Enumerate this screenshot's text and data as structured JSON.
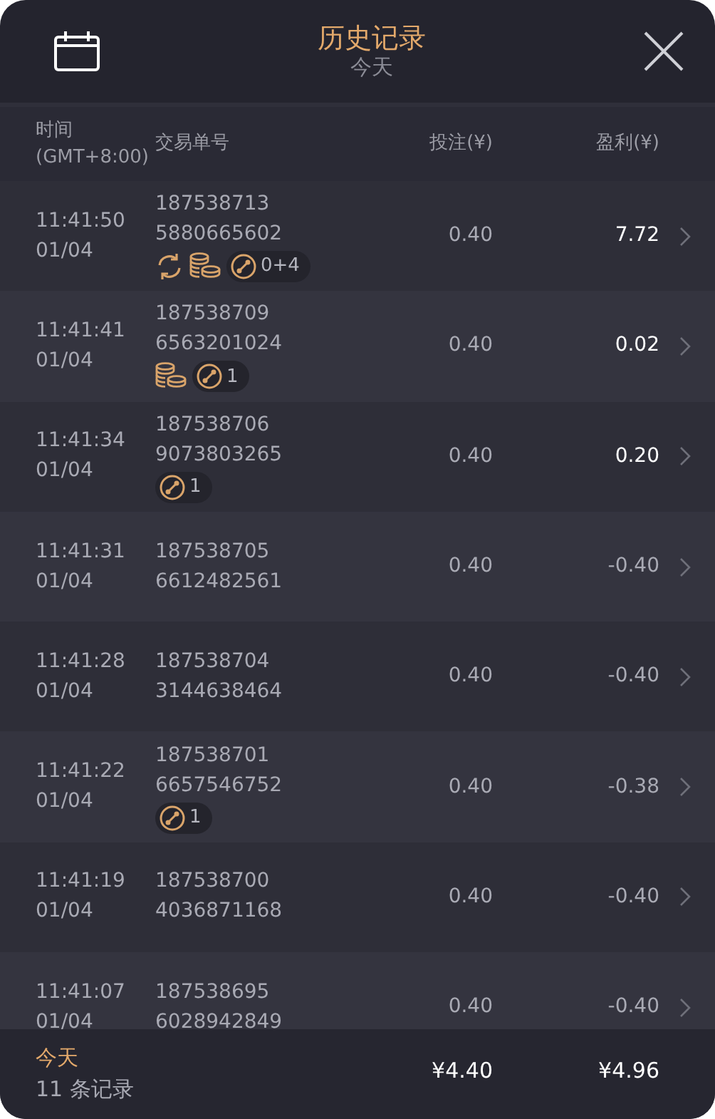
{
  "header": {
    "title": "历史记录",
    "subtitle": "今天"
  },
  "columns": {
    "time": "时间",
    "timezone": "(GMT+8:00)",
    "order": "交易单号",
    "bet": "投注(¥)",
    "profit": "盈利(¥)"
  },
  "rows": [
    {
      "time": "11:41:50",
      "date": "01/04",
      "order_a": "187538713",
      "order_b": "5880665602",
      "tags": [
        {
          "kind": "refresh"
        },
        {
          "kind": "coins"
        },
        {
          "kind": "parlay",
          "count": "0+4"
        }
      ],
      "bet": "0.40",
      "profit": "7.72",
      "win": true
    },
    {
      "time": "11:41:41",
      "date": "01/04",
      "order_a": "187538709",
      "order_b": "6563201024",
      "tags": [
        {
          "kind": "coins"
        },
        {
          "kind": "parlay",
          "count": "1"
        }
      ],
      "bet": "0.40",
      "profit": "0.02",
      "win": true
    },
    {
      "time": "11:41:34",
      "date": "01/04",
      "order_a": "187538706",
      "order_b": "9073803265",
      "tags": [
        {
          "kind": "parlay",
          "count": "1"
        }
      ],
      "bet": "0.40",
      "profit": "0.20",
      "win": true
    },
    {
      "time": "11:41:31",
      "date": "01/04",
      "order_a": "187538705",
      "order_b": "6612482561",
      "bet": "0.40",
      "profit": "-0.40",
      "win": false
    },
    {
      "time": "11:41:28",
      "date": "01/04",
      "order_a": "187538704",
      "order_b": "3144638464",
      "bet": "0.40",
      "profit": "-0.40",
      "win": false
    },
    {
      "time": "11:41:22",
      "date": "01/04",
      "order_a": "187538701",
      "order_b": "6657546752",
      "tags": [
        {
          "kind": "parlay",
          "count": "1"
        }
      ],
      "bet": "0.40",
      "profit": "-0.38",
      "win": false
    },
    {
      "time": "11:41:19",
      "date": "01/04",
      "order_a": "187538700",
      "order_b": "4036871168",
      "bet": "0.40",
      "profit": "-0.40",
      "win": false
    },
    {
      "time": "11:41:07",
      "date": "01/04",
      "order_a": "187538695",
      "order_b": "6028942849",
      "bet": "0.40",
      "profit": "-0.40",
      "win": false
    }
  ],
  "footer": {
    "period": "今天",
    "count": "11 条记录",
    "total_bet": "¥4.40",
    "total_profit": "¥4.96"
  }
}
